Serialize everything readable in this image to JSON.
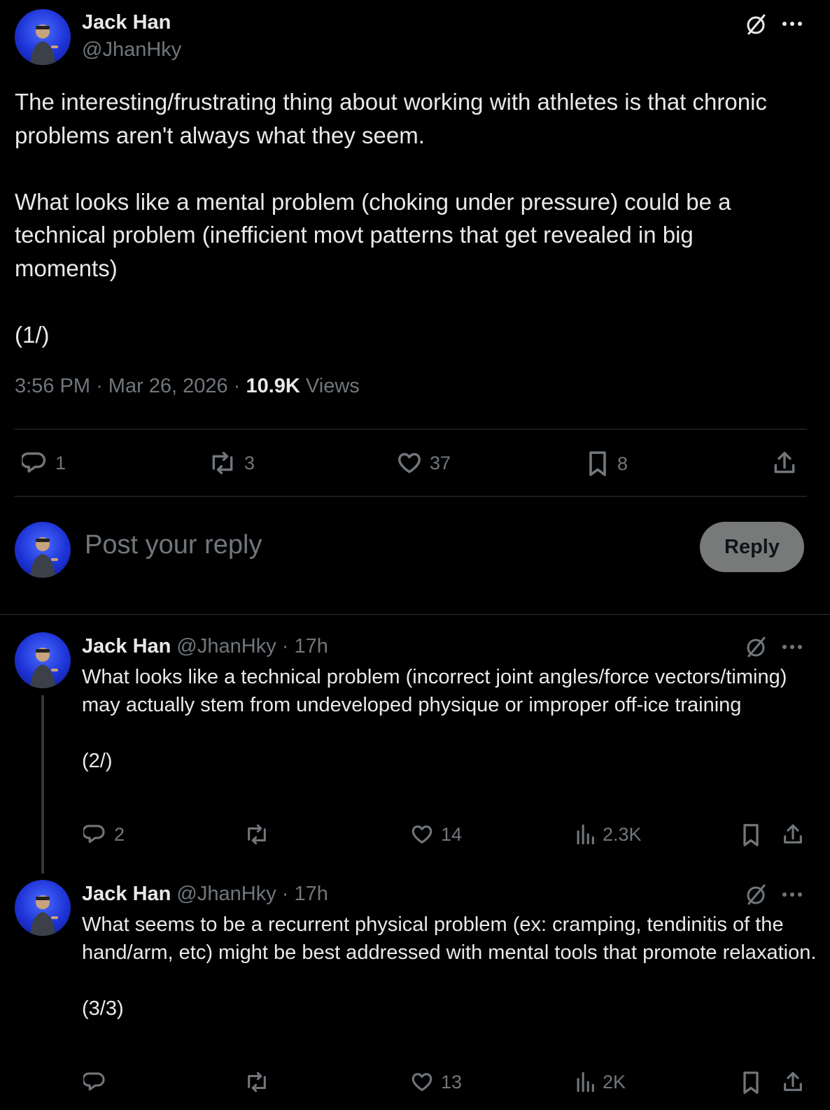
{
  "main_post": {
    "author_name": "Jack Han",
    "author_handle": "@JhanHky",
    "text": "The interesting/frustrating thing about working with athletes is that chronic problems aren't always what they seem.\n\nWhat looks like a mental problem (choking under pressure) could be a technical problem (inefficient movt patterns that get revealed in big moments)\n\n(1/)",
    "time": "3:56 PM",
    "date": "Mar 26, 2026",
    "separator": "·",
    "views_count": "10.9K",
    "views_label": "Views",
    "actions": {
      "replies": "1",
      "reposts": "3",
      "likes": "37",
      "bookmarks": "8"
    }
  },
  "reply_box": {
    "placeholder": "Post your reply",
    "button_label": "Reply"
  },
  "thread": [
    {
      "author_name": "Jack Han",
      "author_handle": "@JhanHky",
      "separator": "·",
      "age": "17h",
      "text": "What looks like a technical problem (incorrect joint angles/force vectors/timing) may actually stem from undeveloped physique or improper off-ice training\n\n(2/)",
      "actions": {
        "replies": "2",
        "reposts": "",
        "likes": "14",
        "views": "2.3K"
      }
    },
    {
      "author_name": "Jack Han",
      "author_handle": "@JhanHky",
      "separator": "·",
      "age": "17h",
      "text": "What seems to be a recurrent physical problem (ex: cramping, tendinitis of the hand/arm, etc) might be best addressed with mental tools that promote relaxation.\n\n(3/3)",
      "actions": {
        "replies": "",
        "reposts": "",
        "likes": "13",
        "views": "2K"
      }
    }
  ],
  "icons": {
    "grok": "grok-icon",
    "more": "more-icon",
    "reply": "reply-icon",
    "repost": "repost-icon",
    "like": "like-icon",
    "bookmark": "bookmark-icon",
    "share": "share-icon",
    "views": "views-icon"
  },
  "colors": {
    "background": "#000000",
    "text": "#e7e9ea",
    "muted": "#71767b",
    "divider": "#2f3336",
    "reply_button": "#787a7a"
  }
}
